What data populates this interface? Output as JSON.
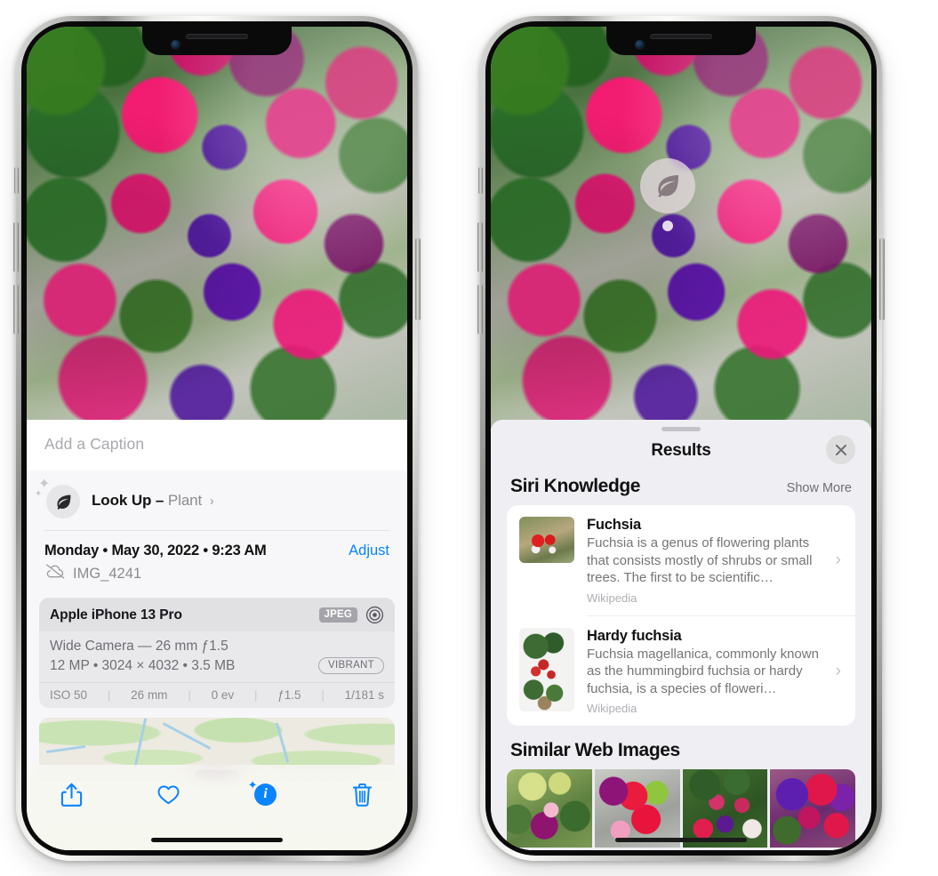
{
  "left_phone": {
    "photo_alt": "fuchsia-flowers-photo",
    "caption_placeholder": "Add a Caption",
    "lookup": {
      "icon": "leaf-icon",
      "label": "Look Up –",
      "subject": "Plant",
      "chevron": "›"
    },
    "metadata": {
      "date": "Monday • May 30, 2022 • 9:23 AM",
      "adjust_label": "Adjust",
      "cloud_icon": "cloud-slash-icon",
      "filename": "IMG_4241"
    },
    "camera_card": {
      "device": "Apple iPhone 13 Pro",
      "format_badge": "JPEG",
      "lens_icon": "lens-icon",
      "lens_line": "Wide Camera — 26 mm ƒ1.5",
      "size_line": "12 MP • 3024 × 4032 • 3.5 MB",
      "style_badge": "VIBRANT",
      "exif": [
        "ISO 50",
        "26 mm",
        "0 ev",
        "ƒ1.5",
        "1/181 s"
      ]
    },
    "map": {
      "name": "photo-location-map",
      "pin": "photo-pin"
    },
    "toolbar": {
      "share": "share-icon",
      "favorite": "heart-icon",
      "info": "info-icon",
      "delete": "trash-icon"
    }
  },
  "right_phone": {
    "photo_alt": "fuchsia-flowers-photo",
    "leaf_badge": "leaf-icon",
    "sheet": {
      "title": "Results",
      "close": "close-icon",
      "siri_knowledge": {
        "title": "Siri Knowledge",
        "show_more": "Show More",
        "items": [
          {
            "title": "Fuchsia",
            "description": "Fuchsia is a genus of flowering plants that consists mostly of shrubs or small trees. The first to be scientific…",
            "source": "Wikipedia",
            "chevron": "›"
          },
          {
            "title": "Hardy fuchsia",
            "description": "Fuchsia magellanica, commonly known as the hummingbird fuchsia or hardy fuchsia, is a species of floweri…",
            "source": "Wikipedia",
            "chevron": "›"
          }
        ]
      },
      "similar_web_images": {
        "title": "Similar Web Images",
        "thumbnails": [
          "web-image-1",
          "web-image-2",
          "web-image-3",
          "web-image-4"
        ]
      }
    }
  },
  "colors": {
    "accent_blue": "#0A84FF",
    "sheet_bg": "#EEEEF3",
    "info_bg": "#F7F7F9",
    "card_bg": "#E9E9EC"
  }
}
